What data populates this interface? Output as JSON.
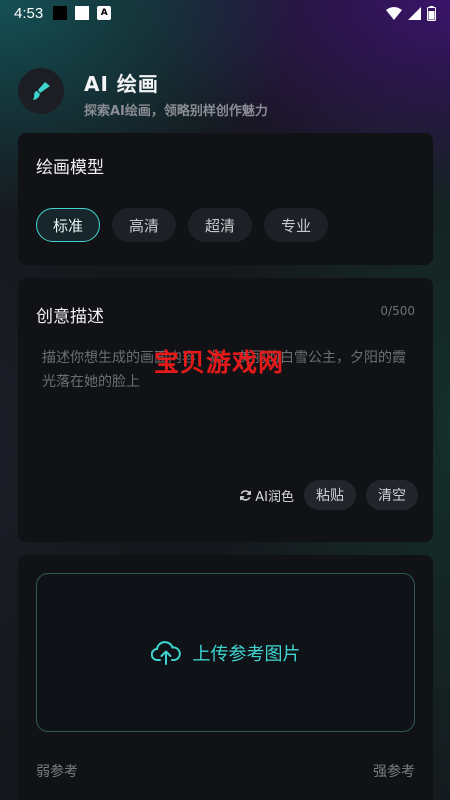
{
  "status_bar": {
    "time": "4:53",
    "a_badge": "A"
  },
  "header": {
    "title": "AI 绘画",
    "subtitle": "探索AI绘画，领略别样创作魅力"
  },
  "model_card": {
    "title": "绘画模型",
    "options": [
      "标准",
      "高清",
      "超清",
      "专业"
    ],
    "selected": "标准"
  },
  "description_card": {
    "title": "创意描述",
    "counter": "0/500",
    "placeholder": "描述你想生成的画面内容，如：美丽的白雪公主，夕阳的霞光落在她的脸上",
    "polish_label": "AI润色",
    "paste_label": "粘贴",
    "clear_label": "清空"
  },
  "watermark": "宝贝游戏网",
  "upload_card": {
    "upload_label": "上传参考图片",
    "weak_label": "弱参考",
    "strong_label": "强参考"
  },
  "colors": {
    "accent": "#3fd4d0",
    "background": "#15171c",
    "card": "#101216"
  }
}
